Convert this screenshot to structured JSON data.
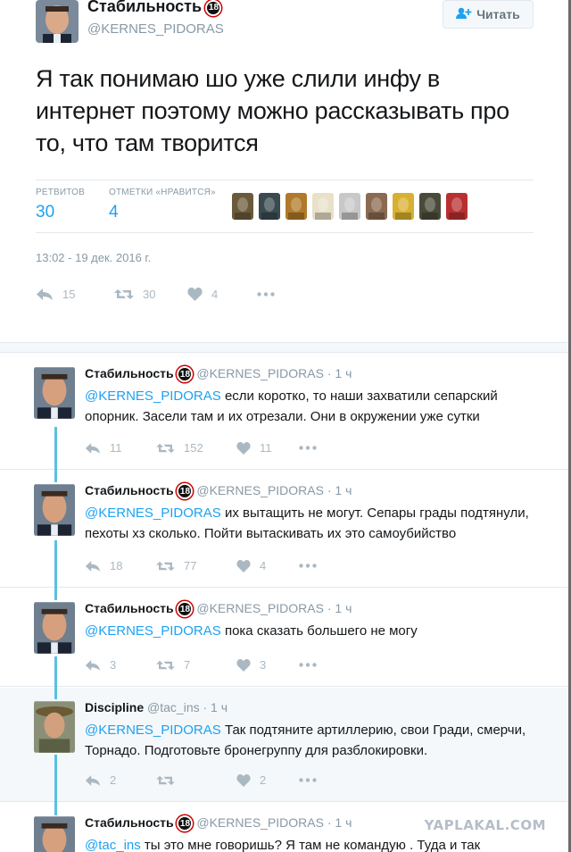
{
  "main_tweet": {
    "name": "Стабильность",
    "badge": "18",
    "handle": "@KERNES_PIDORAS",
    "follow_label": "Читать",
    "text": "Я так понимаю шо уже слили инфу в интернет поэтому можно рассказывать про то, что там творится",
    "retweets_label": "РЕТВИТОВ",
    "retweets": "30",
    "likes_label": "ОТМЕТКИ «НРАВИТСЯ»",
    "likes": "4",
    "timestamp": "13:02 - 19 дек. 2016 г.",
    "actions": {
      "reply": "15",
      "retweet": "30",
      "like": "4"
    },
    "liker_colors": [
      "#6b5a3a",
      "#3a4a4e",
      "#b07a2a",
      "#e8e0c8",
      "#c8c8c8",
      "#8a6a50",
      "#d8b030",
      "#4a4a3a",
      "#b83030"
    ]
  },
  "replies": [
    {
      "name": "Стабильность",
      "badge": "18",
      "handle": "@KERNES_PIDORAS",
      "time": "· 1 ч",
      "mention": "@KERNES_PIDORAS",
      "text": " если коротко, то наши захватили сепарский опорник. Засели там и их отрезали. Они в окружении уже сутки",
      "actions": {
        "reply": "11",
        "retweet": "152",
        "like": "11"
      }
    },
    {
      "name": "Стабильность",
      "badge": "18",
      "handle": "@KERNES_PIDORAS",
      "time": "· 1 ч",
      "mention": "@KERNES_PIDORAS",
      "text": " их вытащить не могут. Сепары грады подтянули, пехоты хз сколько. Пойти вытаскивать их это самоубийство",
      "actions": {
        "reply": "18",
        "retweet": "77",
        "like": "4"
      }
    },
    {
      "name": "Стабильность",
      "badge": "18",
      "handle": "@KERNES_PIDORAS",
      "time": "· 1 ч",
      "mention": "@KERNES_PIDORAS",
      "text": " пока сказать большего не могу",
      "actions": {
        "reply": "3",
        "retweet": "7",
        "like": "3"
      }
    },
    {
      "name": "Discipline",
      "badge": "",
      "handle": "@tac_ins",
      "time": "· 1 ч",
      "mention": "@KERNES_PIDORAS",
      "text": " Так подтяните артиллерию, свои Гради, смерчи, Торнадо. Подготовьте броне­группу для разблокировки.",
      "actions": {
        "reply": "2",
        "retweet": "",
        "like": "2"
      }
    },
    {
      "name": "Стабильность",
      "badge": "18",
      "handle": "@KERNES_PIDORAS",
      "time": "· 1 ч",
      "mention": "@tac_ins",
      "text": " ты это мне говоришь? Я там не командую . Туда и так съехались с",
      "actions": {
        "reply": "",
        "retweet": "",
        "like": ""
      }
    }
  ],
  "watermark": "YAPLAKAL.COM",
  "colors": {
    "accent": "#1da1f2",
    "muted": "#8899a6",
    "icon": "#aab8c2",
    "thread": "#59c1e0"
  }
}
